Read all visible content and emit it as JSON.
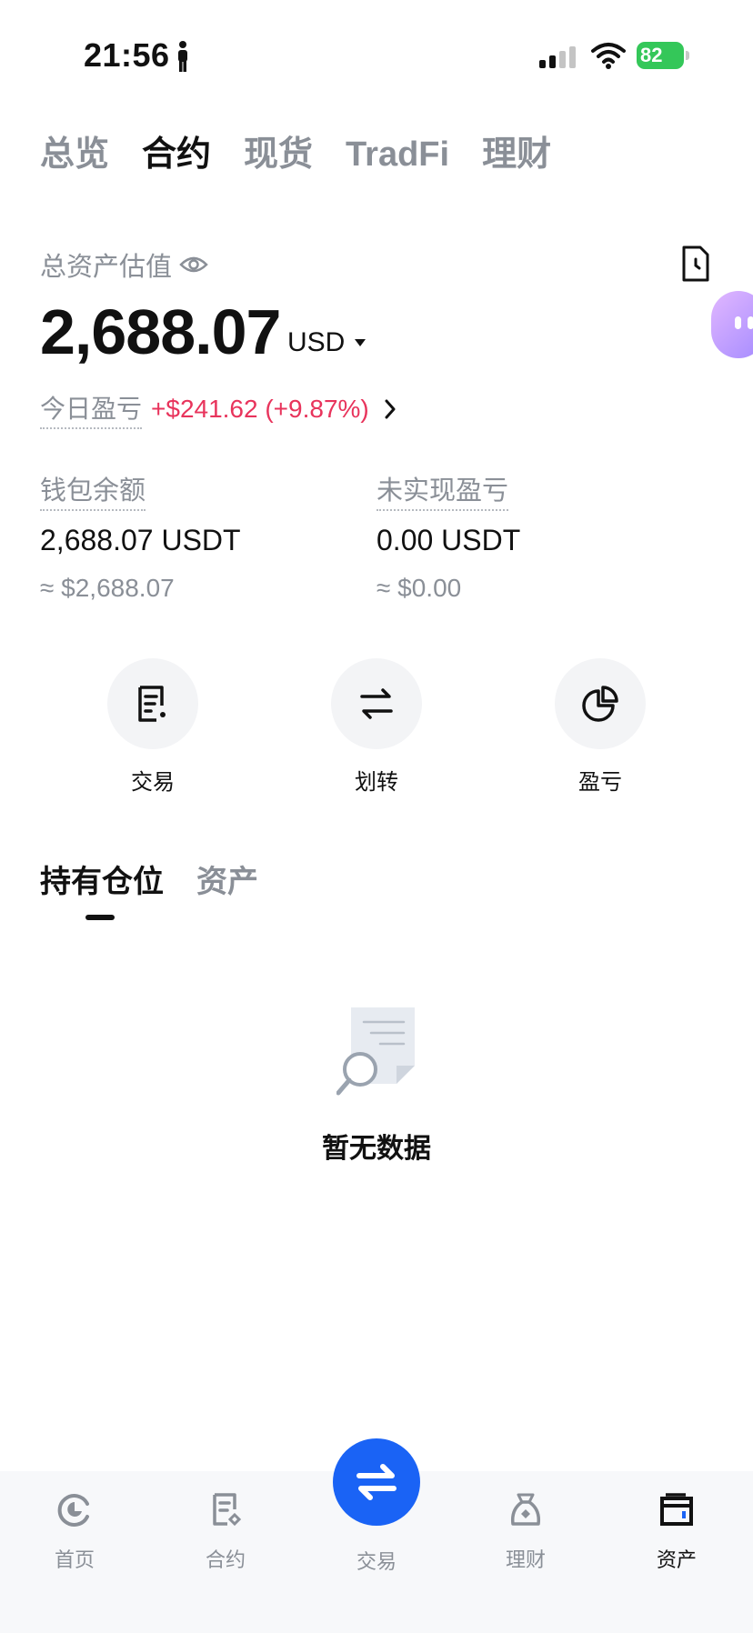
{
  "status_bar": {
    "time": "21:56",
    "battery": "82"
  },
  "top_tabs": [
    {
      "label": "总览",
      "active": false
    },
    {
      "label": "合约",
      "active": true
    },
    {
      "label": "现货",
      "active": false
    },
    {
      "label": "TradFi",
      "active": false
    },
    {
      "label": "理财",
      "active": false
    }
  ],
  "asset": {
    "label": "总资产估值",
    "amount": "2,688.07",
    "currency": "USD",
    "pnl_label": "今日盈亏",
    "pnl_value": "+$241.62 (+9.87%)"
  },
  "balances": {
    "wallet": {
      "label": "钱包余额",
      "value": "2,688.07 USDT",
      "approx": "≈ $2,688.07"
    },
    "unrealized": {
      "label": "未实现盈亏",
      "value": "0.00 USDT",
      "approx": "≈ $0.00"
    }
  },
  "actions": [
    {
      "label": "交易",
      "icon": "document-edit-icon"
    },
    {
      "label": "划转",
      "icon": "transfer-arrows-icon"
    },
    {
      "label": "盈亏",
      "icon": "pie-chart-icon"
    }
  ],
  "section_tabs": [
    {
      "label": "持有仓位",
      "active": true
    },
    {
      "label": "资产",
      "active": false
    }
  ],
  "empty_state": {
    "text": "暂无数据"
  },
  "bottom_nav": [
    {
      "label": "首页",
      "icon": "home-icon",
      "active": false
    },
    {
      "label": "合约",
      "icon": "contract-icon",
      "active": false
    },
    {
      "label": "交易",
      "icon": "trade-swap-icon",
      "active": false
    },
    {
      "label": "理财",
      "icon": "finance-bag-icon",
      "active": false
    },
    {
      "label": "资产",
      "icon": "wallet-icon",
      "active": true
    }
  ],
  "colors": {
    "accent_blue": "#1a63f5",
    "profit_red": "#e8345c",
    "battery_green": "#34c759",
    "muted_text": "#8a8f97"
  }
}
